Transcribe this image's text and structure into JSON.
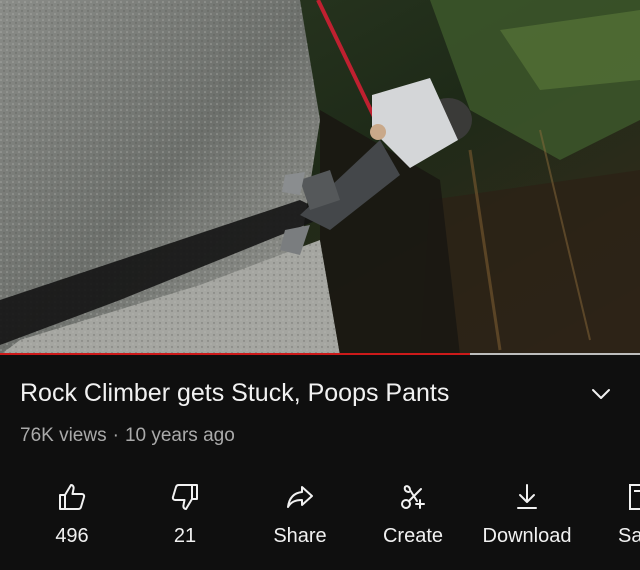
{
  "video": {
    "description_icon": "video-frame",
    "progress": 0.735
  },
  "title": "Rock Climber gets Stuck, Poops Pants",
  "meta": {
    "views": "76K views",
    "separator": "·",
    "age": "10 years ago"
  },
  "actions": {
    "like": {
      "label": "496",
      "icon": "thumbs-up-icon"
    },
    "dislike": {
      "label": "21",
      "icon": "thumbs-down-icon"
    },
    "share": {
      "label": "Share",
      "icon": "share-arrow-icon"
    },
    "create": {
      "label": "Create",
      "icon": "sparkle-scissors-icon"
    },
    "download": {
      "label": "Download",
      "icon": "download-icon"
    },
    "save": {
      "label": "Sa",
      "icon": "save-playlist-icon"
    }
  },
  "colors": {
    "background": "#0f0f0f",
    "progress_played": "#cc1a1a",
    "progress_track": "#bdbdbd",
    "secondary_text": "#aaaaaa"
  }
}
